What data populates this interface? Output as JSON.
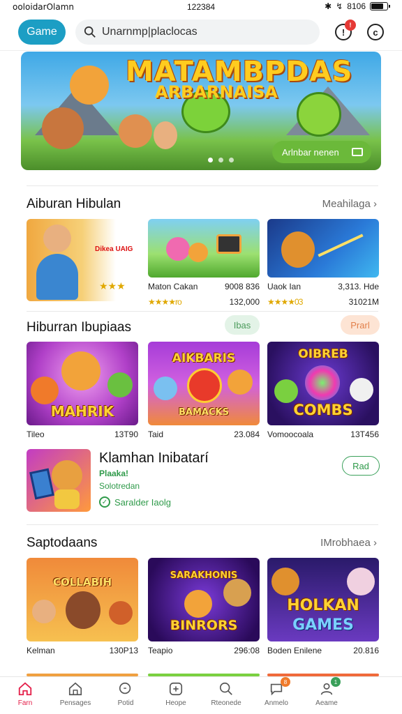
{
  "status_bar": {
    "carrier": "ooloidarOlamn",
    "time": "122384",
    "battery": "8106"
  },
  "header": {
    "logo_label": "Game",
    "search": {
      "value": "Unarnmp|placlocas",
      "placeholder": "Unarnmp|placlocas"
    },
    "notification_badge": "!"
  },
  "hero": {
    "title_line1": "MATAMBPDAS",
    "title_line2": "ARBARNAISA",
    "cta_label": "Arlnbar nenen",
    "slide_count": 3,
    "active_slide": 1
  },
  "section1": {
    "title": "Aiburan Hibulan",
    "link": "Meahilaga",
    "cards": [
      {
        "art": "Dikea UAIG",
        "name": "",
        "meta": "",
        "rating": "",
        "count": ""
      },
      {
        "art": "",
        "name": "Maton Cakan",
        "meta": "9008 836",
        "rating": "★★★★ro",
        "count": "132,000"
      },
      {
        "art": "",
        "name": "Uaok Ian",
        "meta": "3,313. Hde",
        "rating": "★★★★03",
        "count": "31021M"
      }
    ]
  },
  "section2": {
    "title": "Hiburran Ibupiaas",
    "pill_green": "Ibas",
    "pill_peach": "Prarl",
    "cards": [
      {
        "art": "MAHRIK",
        "name": "Tileo",
        "meta": "13T90"
      },
      {
        "art": "AIKBARIS",
        "art2": "BAMACKS",
        "name": "Taid",
        "meta": "23.084"
      },
      {
        "art": "OIBREB",
        "art2": "COMBS",
        "name": "Vomoocoala",
        "meta": "13T456"
      }
    ]
  },
  "featured": {
    "title": "Klamhan Inibatarí",
    "sub1": "Plaaka!",
    "sub2": "Solotredan",
    "verified_label": "Saralder Iaolg",
    "button_label": "Rad"
  },
  "section3": {
    "title": "Saptodaans",
    "link": "IMrobhaea",
    "cards": [
      {
        "art": "COLLABIH",
        "name": "Kelman",
        "meta": "130P13"
      },
      {
        "art": "SARAKHONIS",
        "art2": "BINRORS",
        "name": "Teapio",
        "meta": "296:08"
      },
      {
        "art": "HOLKAN",
        "art2": "GAMES",
        "name": "Boden Enilene",
        "meta": "20.816"
      }
    ]
  },
  "bottom_nav": [
    {
      "label": "Farn",
      "icon": "home-icon",
      "active": true
    },
    {
      "label": "Pensages",
      "icon": "store-icon",
      "active": false
    },
    {
      "label": "Potid",
      "icon": "search-alt-icon",
      "active": false
    },
    {
      "label": "Heope",
      "icon": "plus-square-icon",
      "active": false
    },
    {
      "label": "Rteonede",
      "icon": "search-icon",
      "active": false
    },
    {
      "label": "Anmelo",
      "icon": "chat-icon",
      "active": false,
      "badge": "8"
    },
    {
      "label": "Aeame",
      "icon": "profile-icon",
      "active": false,
      "badge": "1"
    }
  ],
  "colors": {
    "accent": "#1c9ec4",
    "active_nav": "#e4204a",
    "green": "#2f9a4a",
    "star": "#e0a800"
  }
}
